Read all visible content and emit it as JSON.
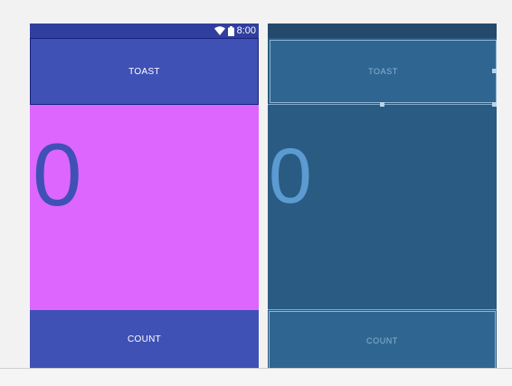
{
  "design": {
    "status_time": "8:00",
    "toast_label": "TOAST",
    "count_value": "0",
    "count_label": "COUNT"
  },
  "blueprint": {
    "toast_label": "TOAST",
    "count_value": "0",
    "count_label": "COUNT"
  },
  "colors": {
    "primary": "#3f51b5",
    "primary_dark": "#303f9f",
    "middle_background": "#dd66ff",
    "blueprint_background": "#2a5b82"
  },
  "icons": [
    "wifi-icon",
    "battery-icon"
  ]
}
